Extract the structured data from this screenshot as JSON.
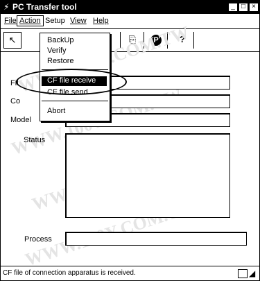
{
  "window": {
    "title_icon": "⚡",
    "title": "PC Transfer tool",
    "controls": {
      "minimize": "_",
      "maximize": "□",
      "close": "×"
    }
  },
  "menubar": {
    "items": [
      {
        "label": "File"
      },
      {
        "label": "Action"
      },
      {
        "label": "Setup"
      },
      {
        "label": "View"
      },
      {
        "label": "Help"
      }
    ]
  },
  "toolbar": {
    "buttons": [
      {
        "icon": "transfer-icon",
        "glyph": "↖"
      },
      {
        "icon": "upload-icon",
        "glyph": "⇡"
      },
      {
        "icon": "pc-transfer-icon",
        "glyph": "⎘"
      },
      {
        "icon": "p-circle-icon",
        "glyph": "P"
      },
      {
        "icon": "help-icon",
        "glyph": "?"
      }
    ]
  },
  "action_menu": {
    "items": [
      {
        "label": "BackUp"
      },
      {
        "label": "Verify"
      },
      {
        "label": "Restore"
      },
      {
        "label": "CF file receive"
      },
      {
        "label": "CF file send"
      },
      {
        "label": "Abort"
      }
    ],
    "selected": "CF file receive"
  },
  "form": {
    "file_label": "Fil",
    "comment_label": "Co",
    "model_label": "Model",
    "status_label": "Status",
    "process_label": "Process"
  },
  "statusbar": {
    "text": "CF file of connection apparatus is received."
  },
  "watermark": {
    "text": "WWW.100Y.COM.TW"
  },
  "colors": {
    "titlebar": "#000000",
    "highlight": "#000000",
    "background": "#ffffff"
  }
}
